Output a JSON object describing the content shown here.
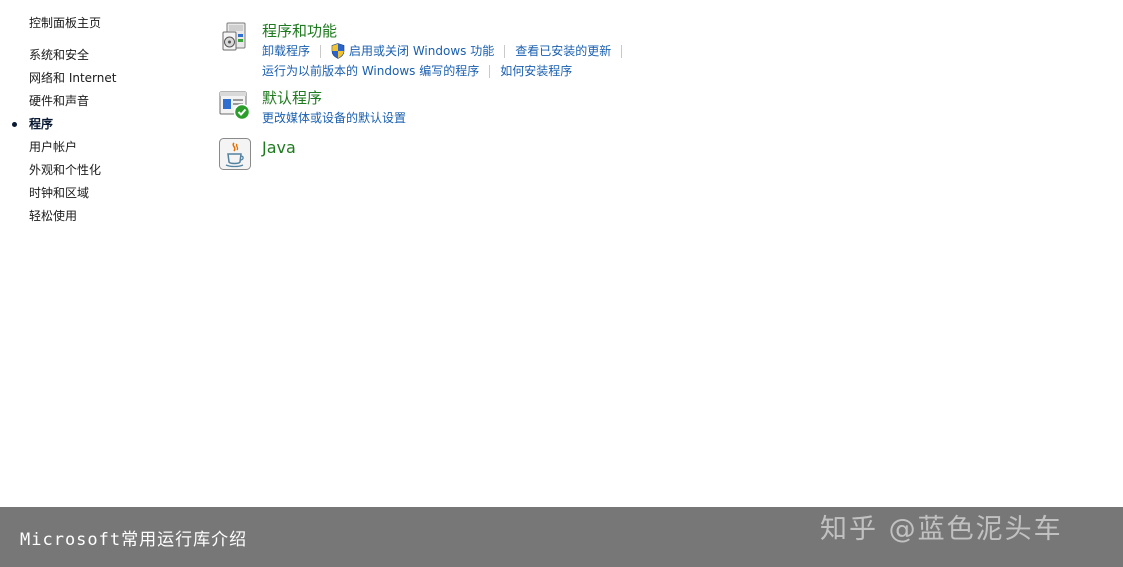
{
  "left_nav": {
    "home": "控制面板主页",
    "items": [
      {
        "label": "系统和安全"
      },
      {
        "label": "网络和 Internet"
      },
      {
        "label": "硬件和声音"
      },
      {
        "label": "程序",
        "active": true
      },
      {
        "label": "用户帐户"
      },
      {
        "label": "外观和个性化"
      },
      {
        "label": "时钟和区域"
      },
      {
        "label": "轻松使用"
      }
    ]
  },
  "categories": {
    "programs_features": {
      "icon": "programs-features-icon",
      "title": "程序和功能",
      "links": {
        "uninstall": "卸载程序",
        "windows_features": "启用或关闭 Windows 功能",
        "installed_updates": "查看已安装的更新",
        "compat": "运行为以前版本的 Windows 编写的程序",
        "how_install": "如何安装程序"
      }
    },
    "default_programs": {
      "icon": "default-programs-icon",
      "title": "默认程序",
      "links": {
        "change_defaults": "更改媒体或设备的默认设置"
      }
    },
    "java": {
      "icon": "java-icon",
      "title": "Java"
    }
  },
  "caption": {
    "text": "Microsoft常用运行库介绍",
    "watermark": "知乎 @蓝色泥头车"
  },
  "colors": {
    "category_title": "#1e7a1e",
    "link": "#1a5fb0",
    "caption_bar": "#777777"
  }
}
